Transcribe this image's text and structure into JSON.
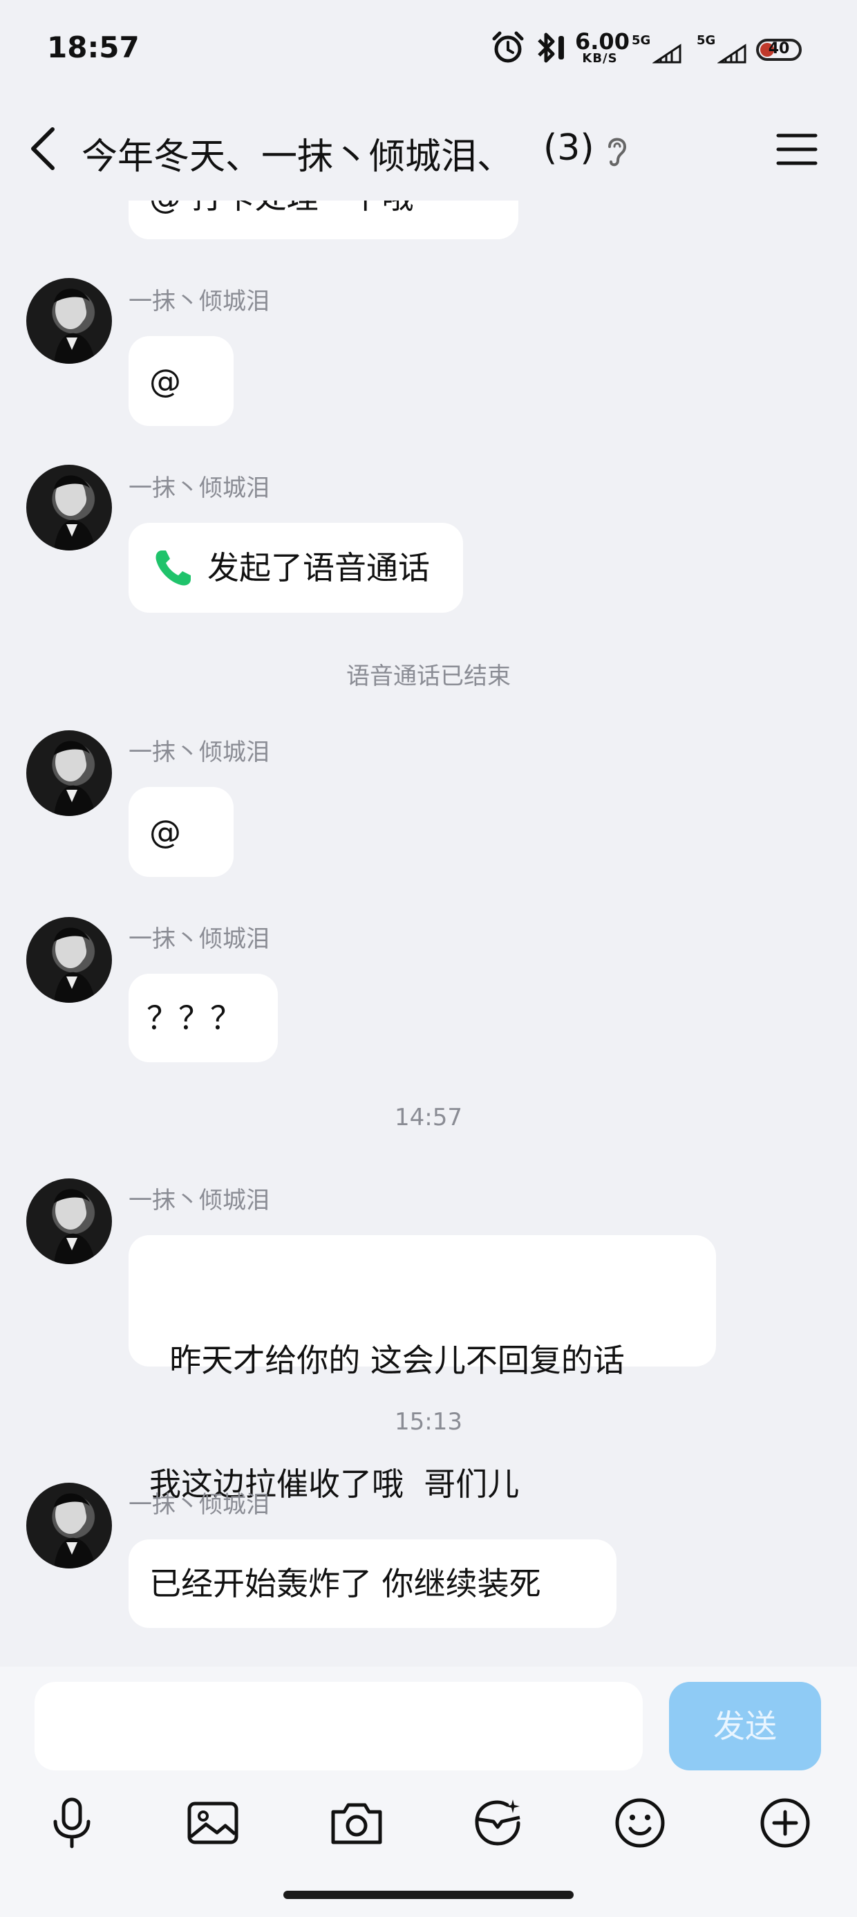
{
  "status_bar": {
    "time": "18:57",
    "net_speed_value": "6.00",
    "net_speed_unit": "KB/S",
    "signal1_label": "5G",
    "signal2_label": "5G",
    "battery_level": "40",
    "icons": [
      "alarm-icon",
      "bluetooth-icon",
      "signal-icon",
      "signal-icon",
      "battery-icon"
    ]
  },
  "header": {
    "title": "今年冬天、一抹丶倾城泪、",
    "member_count": "(3)",
    "icons": [
      "back-icon",
      "ear-icon",
      "menu-icon"
    ]
  },
  "messages": {
    "clipped": "@ 打卡处理一下哦",
    "m1": {
      "sender": "一抹丶倾城泪",
      "text": "@"
    },
    "m2": {
      "sender": "一抹丶倾城泪",
      "text": "发起了语音通话"
    },
    "sys1": "语音通话已结束",
    "m3": {
      "sender": "一抹丶倾城泪",
      "text": "@"
    },
    "m4": {
      "sender": "一抹丶倾城泪",
      "text": "？？？"
    },
    "time1": "14:57",
    "m5": {
      "sender": "一抹丶倾城泪",
      "line1": "  昨天才给你的 这会儿不回复的话",
      "line2": "我这边拉催收了哦  哥们儿"
    },
    "time2": "15:13",
    "m6": {
      "sender": "一抹丶倾城泪",
      "text": "已经开始轰炸了 你继续装死"
    }
  },
  "input": {
    "placeholder": "",
    "send_label": "发送"
  },
  "toolbar": {
    "icons": [
      "microphone-icon",
      "image-icon",
      "camera-icon",
      "sticker-icon",
      "emoji-icon",
      "plus-icon"
    ]
  },
  "colors": {
    "background": "#f0f1f5",
    "bubble": "#ffffff",
    "send_button": "#8fcbf5",
    "call_icon": "#1fc36b",
    "meta_text": "#8a8c94"
  }
}
